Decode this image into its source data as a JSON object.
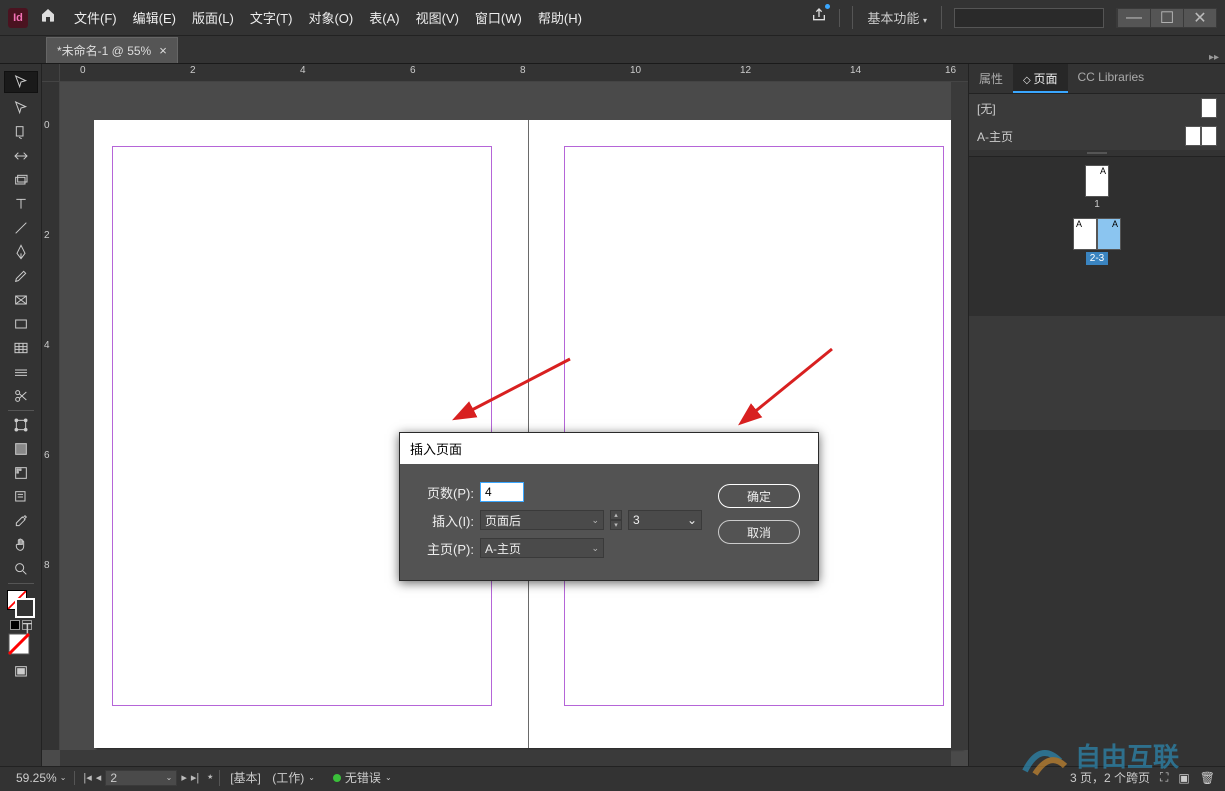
{
  "app": {
    "logo_text": "Id"
  },
  "menu": {
    "file": "文件(F)",
    "edit": "编辑(E)",
    "layout": "版面(L)",
    "type": "文字(T)",
    "object": "对象(O)",
    "table": "表(A)",
    "view": "视图(V)",
    "window": "窗口(W)",
    "help": "帮助(H)"
  },
  "workspace": "基本功能",
  "win_ctrl": {
    "min": "—",
    "max": "☐",
    "close": "✕"
  },
  "tab": {
    "title": "*未命名-1 @ 55%",
    "close": "×"
  },
  "ruler_h": [
    "0",
    "2",
    "4",
    "6",
    "8",
    "10",
    "12",
    "14",
    "16"
  ],
  "ruler_v": [
    "0",
    "2",
    "4",
    "6",
    "8"
  ],
  "dialog": {
    "title": "插入页面",
    "page_count_label": "页数(P):",
    "page_count_value": "4",
    "insert_label": "插入(I):",
    "insert_value": "页面后",
    "after_value": "3",
    "master_label": "主页(P):",
    "master_value": "A-主页",
    "ok": "确定",
    "cancel": "取消"
  },
  "panels": {
    "tabs": {
      "properties": "属性",
      "pages": "页面",
      "cc": "CC Libraries"
    },
    "none": "[无]",
    "a_master": "A-主页",
    "page1_badge": "A",
    "page1_num": "1",
    "spread_left": "A",
    "spread_right": "A",
    "spread_label": "2-3"
  },
  "status": {
    "zoom": "59.25%",
    "current_page": "2",
    "mode_bracket": "[基本]",
    "mode_paren": "(工作)",
    "errors": "无错误",
    "pages_summary": "3 页，2 个跨页"
  },
  "watermark": "自由互联"
}
